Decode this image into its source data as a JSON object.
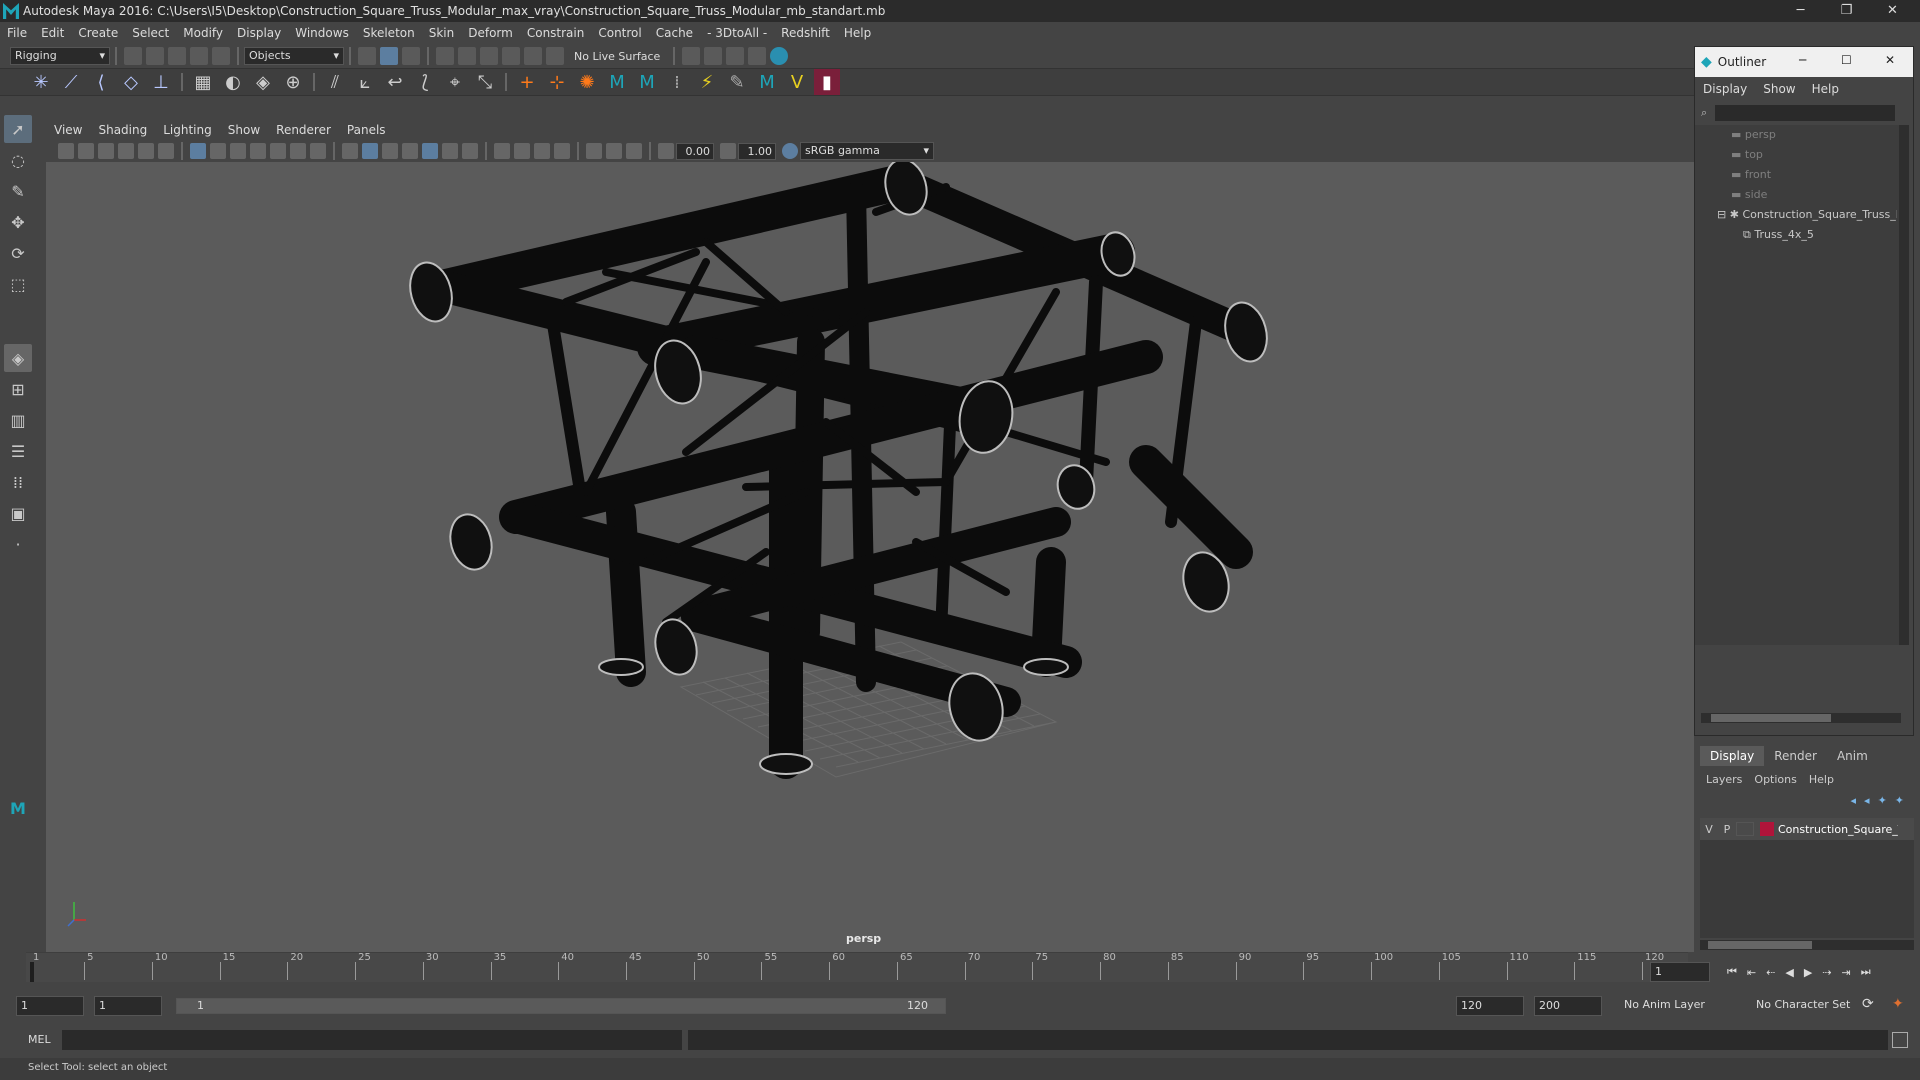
{
  "titlebar": {
    "title": "Autodesk Maya 2016: C:\\Users\\I5\\Desktop\\Construction_Square_Truss_Modular_max_vray\\Construction_Square_Truss_Modular_mb_standart.mb",
    "minimize": "─",
    "restore": "❐",
    "close": "✕"
  },
  "menubar": {
    "items": [
      "File",
      "Edit",
      "Create",
      "Select",
      "Modify",
      "Display",
      "Windows",
      "Skeleton",
      "Skin",
      "Deform",
      "Constrain",
      "Control",
      "Cache",
      "- 3DtoAll -",
      "Redshift",
      "Help"
    ]
  },
  "statusline": {
    "mode": "Rigging",
    "selection_mask": "Objects",
    "live_surface": "No Live Surface"
  },
  "viewport": {
    "menu": [
      "View",
      "Shading",
      "Lighting",
      "Show",
      "Renderer",
      "Panels"
    ],
    "exposure": "0.00",
    "gamma": "1.00",
    "color_space": "sRGB gamma",
    "camera_label": "persp"
  },
  "timeline": {
    "ticks": [
      "1",
      "5",
      "10",
      "15",
      "20",
      "25",
      "30",
      "35",
      "40",
      "45",
      "50",
      "55",
      "60",
      "65",
      "70",
      "75",
      "80",
      "85",
      "90",
      "95",
      "100",
      "105",
      "110",
      "115",
      "120"
    ],
    "current_frame": "1"
  },
  "range": {
    "start": "1",
    "playback_start": "1",
    "slider_start": "1",
    "slider_end": "120",
    "playback_end": "120",
    "end": "200",
    "anim_layer": "No Anim Layer",
    "character_set": "No Character Set"
  },
  "cmdline": {
    "label": "MEL"
  },
  "helpline": {
    "text": "Select Tool: select an object"
  },
  "outliner": {
    "title": "Outliner",
    "menu": [
      "Display",
      "Show",
      "Help"
    ],
    "items": [
      {
        "label": "persp",
        "type": "camera"
      },
      {
        "label": "top",
        "type": "camera"
      },
      {
        "label": "front",
        "type": "camera"
      },
      {
        "label": "side",
        "type": "camera"
      },
      {
        "label": "Construction_Square_Truss_Modular",
        "type": "group"
      },
      {
        "label": "Truss_4x_5",
        "type": "mesh"
      }
    ]
  },
  "layers": {
    "tabs": [
      "Display",
      "Render",
      "Anim"
    ],
    "menu": [
      "Layers",
      "Options",
      "Help"
    ],
    "row": {
      "v": "V",
      "p": "P",
      "name": "Construction_Square_Truss",
      "color": "#b0143a"
    }
  }
}
